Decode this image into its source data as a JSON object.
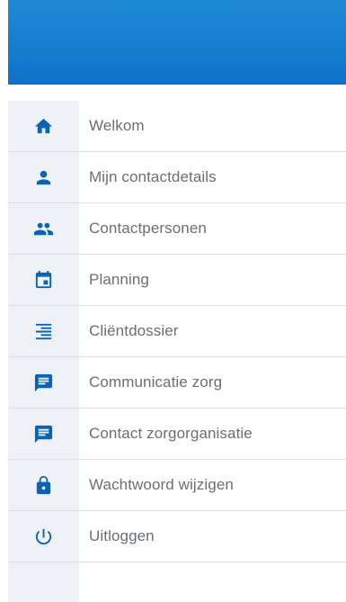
{
  "menu": {
    "items": [
      {
        "label": "Welkom",
        "icon": "home-icon"
      },
      {
        "label": "Mijn contactdetails",
        "icon": "person-icon"
      },
      {
        "label": "Contactpersonen",
        "icon": "people-icon"
      },
      {
        "label": "Planning",
        "icon": "calendar-icon"
      },
      {
        "label": "Cliëntdossier",
        "icon": "list-icon"
      },
      {
        "label": "Communicatie zorg",
        "icon": "chat-icon"
      },
      {
        "label": "Contact zorgorganisatie",
        "icon": "chat-icon"
      },
      {
        "label": "Wachtwoord wijzigen",
        "icon": "lock-icon"
      },
      {
        "label": "Uitloggen",
        "icon": "power-icon"
      }
    ]
  },
  "colors": {
    "header": "#137dce",
    "icon": "#0b63b6",
    "rail": "#eef2f6",
    "text": "#6a6f73"
  }
}
